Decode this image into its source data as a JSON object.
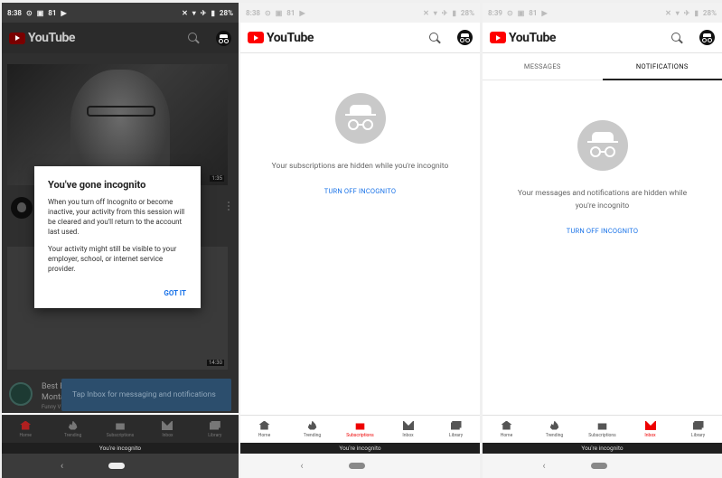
{
  "p1": {
    "status": {
      "time": "8:38",
      "extra": "81",
      "battery": "28%"
    },
    "brand": "YouTube",
    "video_duration": "1:35",
    "video2_duration": "14:30",
    "row3": {
      "title1": "Best Ep",
      "title2": "Monta",
      "channel": "Funny V"
    },
    "dialog": {
      "title": "You've gone incognito",
      "body1": "When you turn off Incognito or become inactive, your activity from this session will be cleared and you'll return to the account last used.",
      "body2": "Your activity might still be visible to your employer, school, or internet service provider.",
      "button": "GOT IT"
    },
    "toast": "Tap Inbox for messaging and notifications",
    "nav": [
      "Home",
      "Trending",
      "Subscriptions",
      "Inbox",
      "Library"
    ],
    "incognito_bar": "You're incognito"
  },
  "p2": {
    "status": {
      "time": "8:38",
      "extra": "81",
      "battery": "28%"
    },
    "brand": "YouTube",
    "empty_msg": "Your subscriptions are hidden while you're incognito",
    "turn_off": "TURN OFF INCOGNITO",
    "nav": [
      "Home",
      "Trending",
      "Subscriptions",
      "Inbox",
      "Library"
    ],
    "incognito_bar": "You're incognito"
  },
  "p3": {
    "status": {
      "time": "8:39",
      "extra": "81",
      "battery": "28%"
    },
    "brand": "YouTube",
    "tabs": [
      "MESSAGES",
      "NOTIFICATIONS"
    ],
    "empty_msg": "Your messages and notifications are hidden while you're incognito",
    "turn_off": "TURN OFF INCOGNITO",
    "nav": [
      "Home",
      "Trending",
      "Subscriptions",
      "Inbox",
      "Library"
    ],
    "incognito_bar": "You're incognito"
  }
}
